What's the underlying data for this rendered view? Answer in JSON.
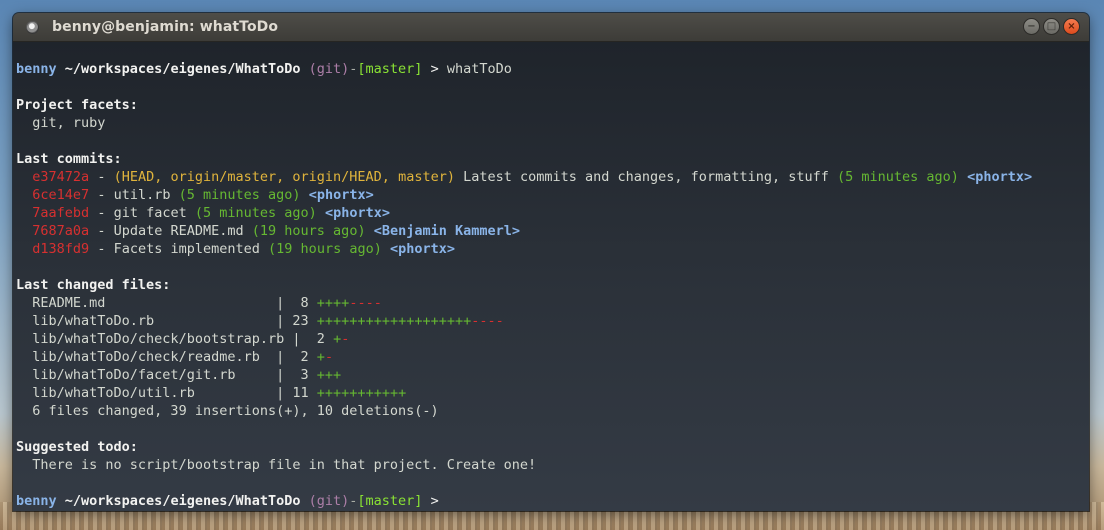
{
  "window": {
    "title": "benny@benjamin: whatToDo"
  },
  "prompt": {
    "user": "benny",
    "path": "~/workspaces/eigenes/WhatToDo",
    "vcs": "(git)",
    "sep": "-",
    "branch": "[master]",
    "symbol": ">"
  },
  "command": "whatToDo",
  "facets": {
    "heading": "Project facets:",
    "list": "git, ruby"
  },
  "commits": {
    "heading": "Last commits:",
    "items": [
      {
        "hash": "e37472a",
        "dash": "-",
        "refs": "(HEAD, origin/master, origin/HEAD, master)",
        "message": "Latest commits and changes, formatting, stuff",
        "time": "(5 minutes ago)",
        "author": "<phortx>"
      },
      {
        "hash": "6ce14e7",
        "dash": "-",
        "refs": "",
        "message": "util.rb",
        "time": "(5 minutes ago)",
        "author": "<phortx>"
      },
      {
        "hash": "7aafebd",
        "dash": "-",
        "refs": "",
        "message": "git facet",
        "time": "(5 minutes ago)",
        "author": "<phortx>"
      },
      {
        "hash": "7687a0a",
        "dash": "-",
        "refs": "",
        "message": "Update README.md",
        "time": "(19 hours ago)",
        "author": "<Benjamin Kammerl>"
      },
      {
        "hash": "d138fd9",
        "dash": "-",
        "refs": "",
        "message": "Facets implemented",
        "time": "(19 hours ago)",
        "author": "<phortx>"
      }
    ]
  },
  "changes": {
    "heading": "Last changed files:",
    "files": [
      {
        "name": "README.md                    ",
        "bar": "|",
        "count": " 8",
        "plus": "++++",
        "minus": "----"
      },
      {
        "name": "lib/whatToDo.rb              ",
        "bar": "|",
        "count": "23",
        "plus": "+++++++++++++++++++",
        "minus": "----"
      },
      {
        "name": "lib/whatToDo/check/bootstrap.rb",
        "bar": "|",
        "count": " 2",
        "plus": "+",
        "minus": "-"
      },
      {
        "name": "lib/whatToDo/check/readme.rb ",
        "bar": "|",
        "count": " 2",
        "plus": "+",
        "minus": "-"
      },
      {
        "name": "lib/whatToDo/facet/git.rb    ",
        "bar": "|",
        "count": " 3",
        "plus": "+++",
        "minus": ""
      },
      {
        "name": "lib/whatToDo/util.rb         ",
        "bar": "|",
        "count": "11",
        "plus": "+++++++++++",
        "minus": ""
      }
    ],
    "summary": "6 files changed, 39 insertions(+), 10 deletions(-)"
  },
  "todo": {
    "heading": "Suggested todo:",
    "text": "There is no script/bootstrap file in that project. Create one!"
  },
  "colors": {
    "prompt_user": "#8ab4e8",
    "vcs": "#ad7fa8",
    "branch": "#8ae234",
    "hash": "#d73030",
    "refs": "#e0b43c",
    "time": "#66b832",
    "author": "#8ab4e8",
    "plus": "#66b832",
    "minus": "#d73030",
    "close_button": "#e9612f"
  },
  "icons": {
    "app": "terminal-app-icon",
    "minimize": "minimize-icon",
    "maximize": "maximize-icon",
    "close": "close-icon"
  }
}
